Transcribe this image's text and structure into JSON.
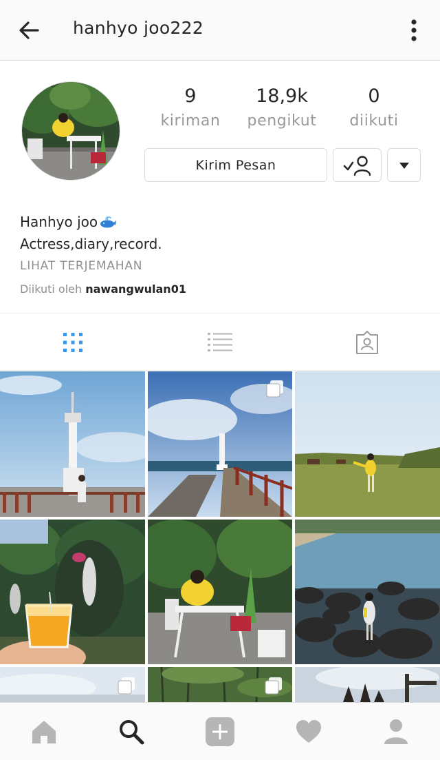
{
  "header": {
    "username": "hanhyo joo222",
    "back_icon": "arrow-left-icon",
    "more_icon": "vertical-dots-icon"
  },
  "profile": {
    "stats": [
      {
        "value": "9",
        "label": "kiriman"
      },
      {
        "value": "18,9k",
        "label": "pengikut"
      },
      {
        "value": "0",
        "label": "diikuti"
      }
    ],
    "message_button": "Kirim Pesan",
    "following_icon": "user-check-icon",
    "dropdown_icon": "caret-down-icon"
  },
  "bio": {
    "name": "Hanhyo joo",
    "name_emoji_icon": "whale-icon",
    "text": "Actress,diary,record.",
    "translate": "LIHAT TERJEMAHAN",
    "followed_by_prefix": "Diikuti oleh ",
    "followed_by_user": "nawangwulan01"
  },
  "tabs": [
    {
      "icon": "grid-icon",
      "active": true
    },
    {
      "icon": "list-icon",
      "active": false
    },
    {
      "icon": "tagged-photo-icon",
      "active": false
    }
  ],
  "grid": [
    {
      "subject": "lighthouse-pier-woman",
      "multi": false
    },
    {
      "subject": "lighthouse-pier",
      "multi": true
    },
    {
      "subject": "field-woman-yellow",
      "multi": false
    },
    {
      "subject": "garden-juice-glass",
      "multi": false
    },
    {
      "subject": "woman-yellow-table",
      "multi": false
    },
    {
      "subject": "rocky-coast-woman",
      "multi": false
    },
    {
      "subject": "sky",
      "multi": true
    },
    {
      "subject": "forest",
      "multi": true
    },
    {
      "subject": "sky-hand",
      "multi": false
    }
  ],
  "bottom_nav": [
    {
      "icon": "home-icon",
      "active": false
    },
    {
      "icon": "search-icon",
      "active": true
    },
    {
      "icon": "add-icon",
      "active": false
    },
    {
      "icon": "heart-icon",
      "active": false
    },
    {
      "icon": "profile-icon",
      "active": false
    }
  ],
  "colors": {
    "accent": "#3897f0",
    "inactive_icon": "#b5b5b5",
    "text_muted": "#999999"
  }
}
